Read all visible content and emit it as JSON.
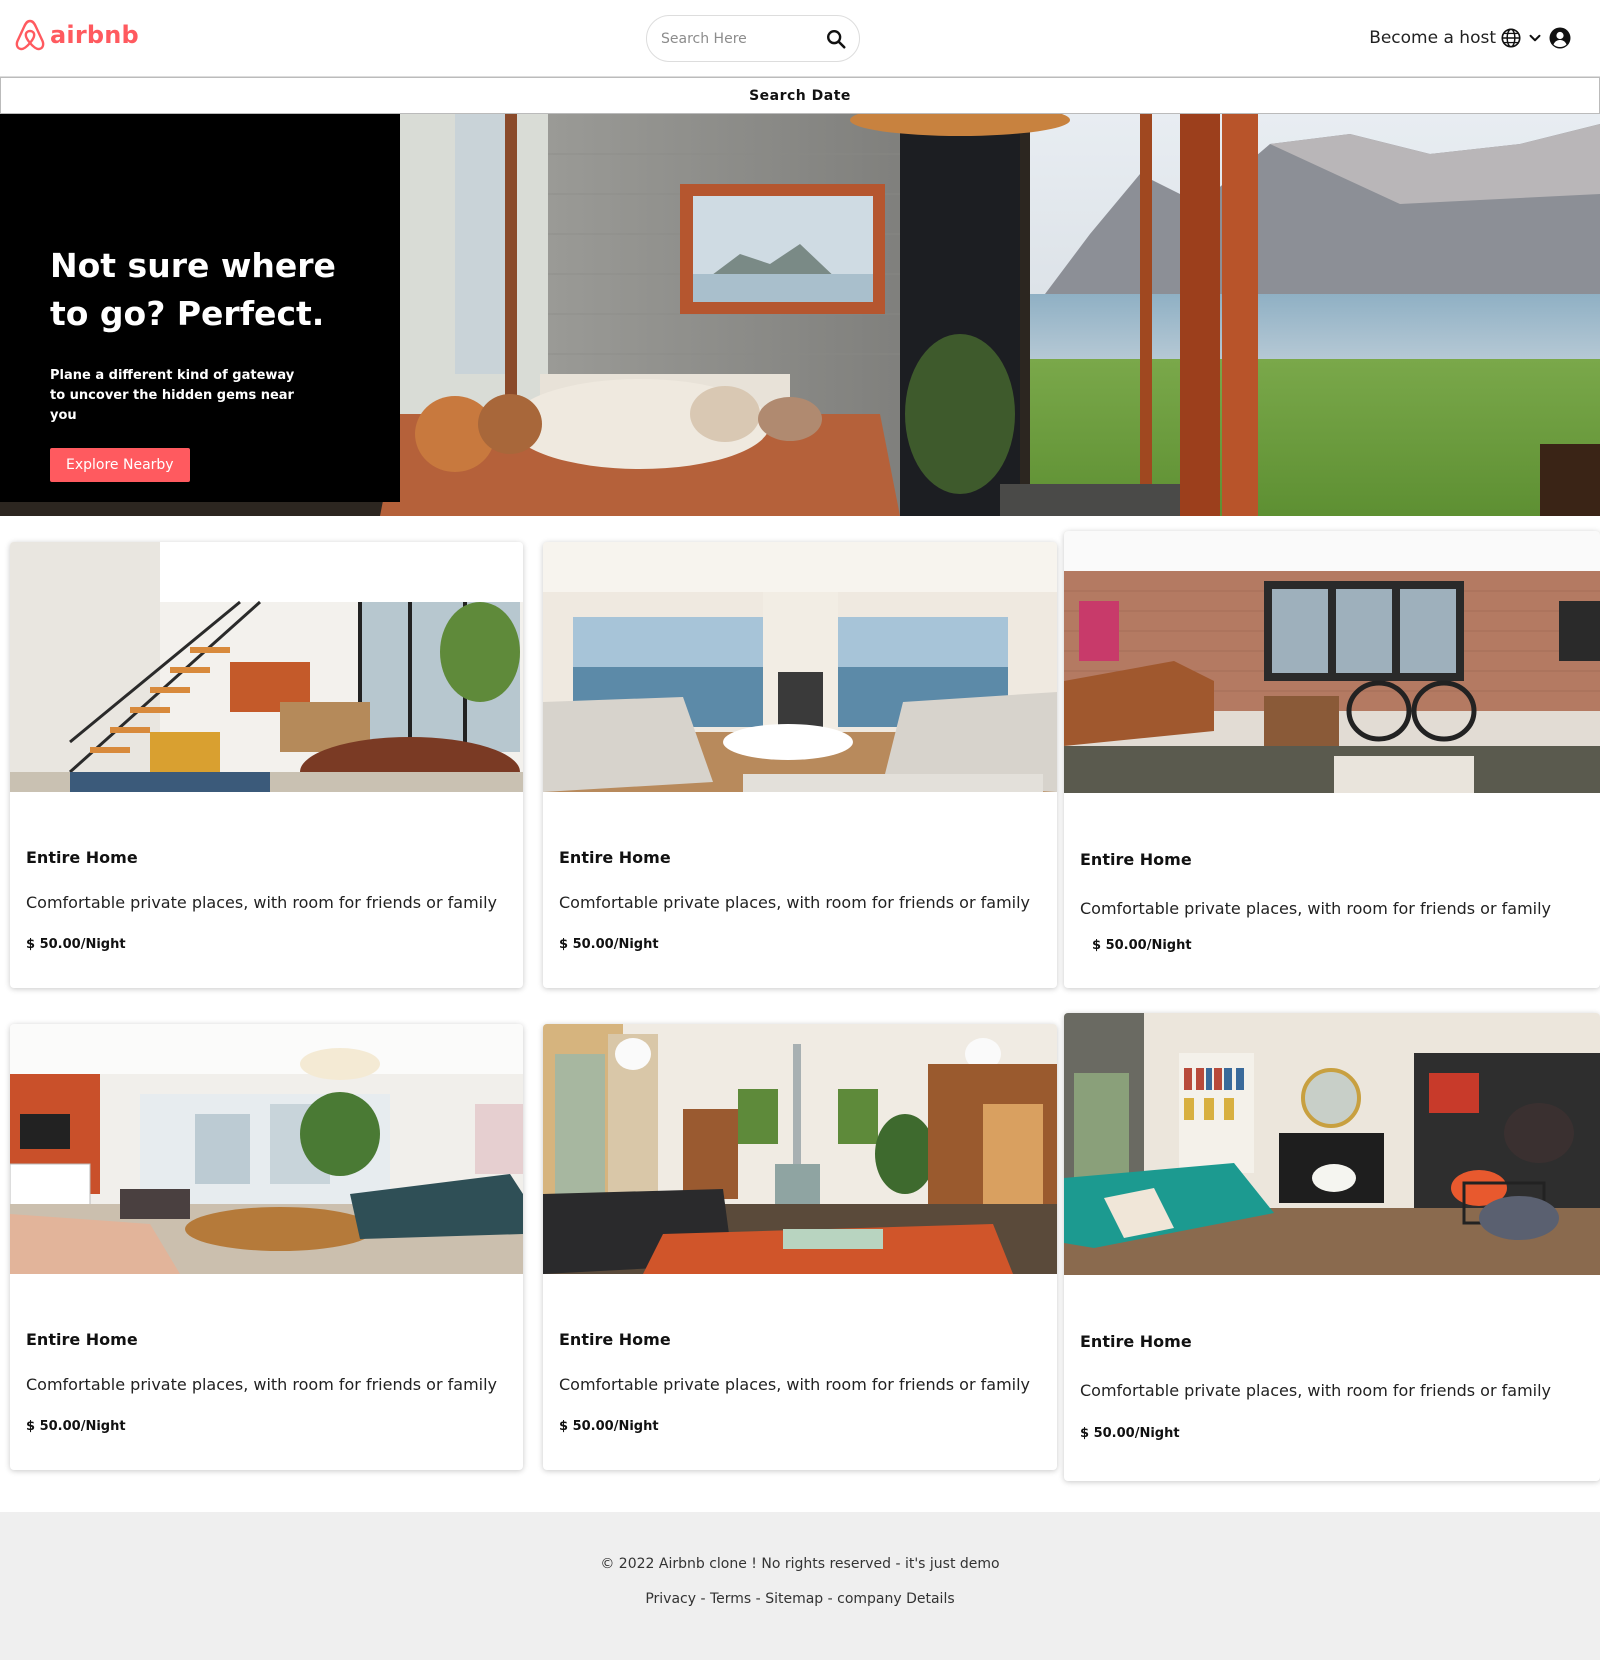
{
  "header": {
    "logo_text": "airbnb",
    "search_placeholder": "Search Here",
    "host_label": "Become a host",
    "icons": [
      "airbnb-logo-icon",
      "search-icon",
      "globe-icon",
      "chevron-down-icon",
      "user-icon"
    ]
  },
  "datebar": {
    "label": "Search Date"
  },
  "hero": {
    "title": "Not sure where to go? Perfect.",
    "subtitle": "Plane a different kind of gateway to uncover the hidden gems near you",
    "button": "Explore Nearby"
  },
  "listings": [
    {
      "title": "Entire Home",
      "desc": "Comfortable private places, with room for friends or family",
      "price": "$ 50.00/Night"
    },
    {
      "title": "Entire Home",
      "desc": "Comfortable private places, with room for friends or family",
      "price": "$ 50.00/Night"
    },
    {
      "title": "Entire Home",
      "desc": "Comfortable private places, with room for friends or family",
      "price": "$ 50.00/Night"
    },
    {
      "title": "Entire Home",
      "desc": "Comfortable private places, with room for friends or family",
      "price": "$ 50.00/Night"
    },
    {
      "title": "Entire Home",
      "desc": "Comfortable private places, with room for friends or family",
      "price": "$ 50.00/Night"
    },
    {
      "title": "Entire Home",
      "desc": "Comfortable private places, with room for friends or family",
      "price": "$ 50.00/Night"
    }
  ],
  "footer": {
    "copyright": "© 2022 Airbnb clone ! No rights reserved - it's just demo",
    "links": [
      "Privacy",
      "Terms",
      "Sitemap",
      "company Details"
    ],
    "separator": " - "
  },
  "colors": {
    "brand": "#ff5a5f",
    "footer_bg": "#efefef"
  }
}
